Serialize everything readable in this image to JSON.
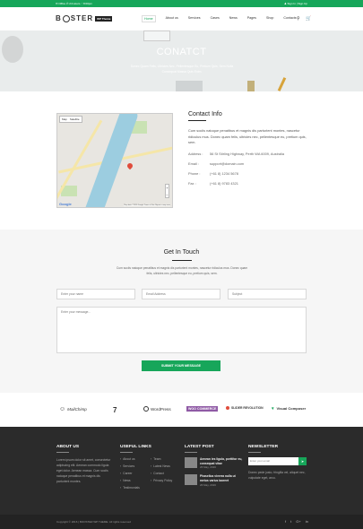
{
  "topbar": {
    "left": "✉ Office ✆ 24 Hours ◔ 8:00pm",
    "right": "♟ Sign In | Sign Up"
  },
  "header": {
    "logo_left": "B",
    "logo_right": "STER",
    "logo_badge": "WP Theme",
    "nav": [
      "Home",
      "About us",
      "Services",
      "Cases",
      "News",
      "Pages",
      "Shop",
      "Contacts"
    ]
  },
  "hero": {
    "title": "CONATCT",
    "subtitle": "Donec Quam Felis, Ultricies Nec, Pellentesque Eu, Pretium Quis, Sem Nulla Consequat Massa Quis Enim."
  },
  "map": {
    "type_map": "Map",
    "type_sat": "Satellite",
    "logo": "Google",
    "credit": "Map data ©2016 Google  Terms of Use  Report a map error",
    "zoom_in": "+",
    "zoom_out": "−"
  },
  "contact": {
    "title": "Contact Info",
    "description": "Cum sociis natoque penatibus et magnis dis parturient montes, nascetur ridiculus mus. Donec quam felis, ultricies nec, pellentesque eu, pretium quis, sem.",
    "rows": [
      {
        "key": "Address :",
        "value": "56 St Stirling Highway, Perth WA 6009, Australia"
      },
      {
        "key": "Email :",
        "value": "support@domain.com"
      },
      {
        "key": "Phone :",
        "value": "(+61 8) 1234 5678"
      },
      {
        "key": "Fax :",
        "value": "(+61 8) 9783 4321"
      }
    ]
  },
  "touch": {
    "title": "Get In Touch",
    "description": "Cum sociis natoque penatibus et magnis dis parturient montes, nascetur ridiculus mus. Donec quam felis, ultricies nec, pellentesque eu, pretium quis, sem.",
    "name_placeholder": "Enter your name",
    "email_placeholder": "Email Address",
    "subject_placeholder": "Subject",
    "message_placeholder": "Enter your message...",
    "submit": "SUBMIT YOUR MESSAGE"
  },
  "brands": [
    "MailChimp",
    "7",
    "WordPress",
    "WOO COMMERCE",
    "SLIDER REVOLUTION",
    "Visual Composer"
  ],
  "footer": {
    "about_title": "ABOUT US",
    "about_text": "Lorem ipsum dolor sit amet, consectetur adipiscing elit. Aenean commodo ligula eget dolor. Aenean massa. Cum sociis natoque penatibus et magnis dis parturient montes.",
    "links_title": "USEFUL LINKS",
    "links_col1": [
      "About us",
      "Services",
      "Career",
      "News",
      "Testimonials"
    ],
    "links_col2": [
      "Team",
      "Latest News",
      "Contact",
      "Privacy Policy"
    ],
    "posts_title": "LATEST POST",
    "posts": [
      {
        "title": "Aenean ies ligula, porttitor eu, consequat vitae",
        "date": "26 May, 2016"
      },
      {
        "title": "Phasellus viverra nulla ut metus varius laoreet",
        "date": "26 May, 2016"
      }
    ],
    "newsletter_title": "NEWSLETTER",
    "newsletter_placeholder": "Enter your email",
    "newsletter_btn": "➤",
    "newsletter_text": "Donec pede justo, fringilla vel, aliquet nec, vulputate eget, arcu."
  },
  "bottom": {
    "copyright": "Copyright © 2016 | BOOSTER WP THEME. All rights reserved",
    "social": [
      "f",
      "t",
      "G+",
      "in"
    ]
  },
  "colors": {
    "accent": "#17a65a",
    "footer": "#2b2b2b"
  }
}
